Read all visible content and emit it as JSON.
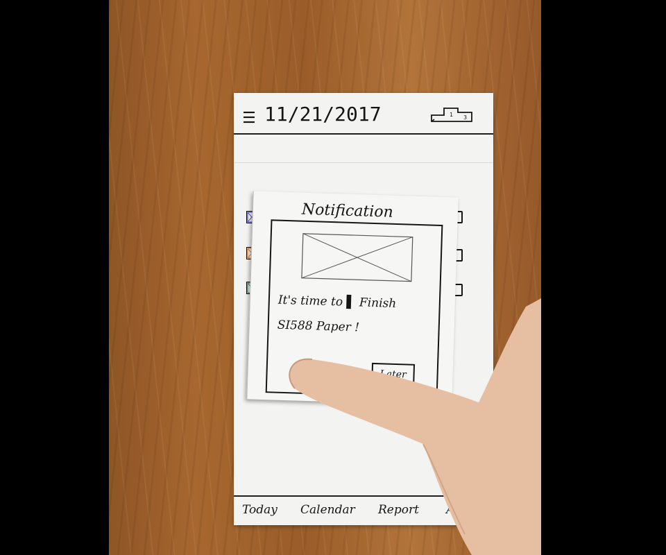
{
  "header": {
    "date": "11/21/2017",
    "menu_icon": "hamburger-menu-icon",
    "leaderboard_icon": "podium-icon"
  },
  "tasks": [
    {
      "color": "#5b5fc7"
    },
    {
      "color": "#e9842f"
    },
    {
      "color": "#4f8a6a"
    }
  ],
  "notification": {
    "title": "Notification",
    "message_line1": "It's time to ▌ Finish",
    "message_line2": "SI588 Paper !",
    "later_label": "Later",
    "image_icon": "image-placeholder-icon"
  },
  "nav": {
    "today": "Today",
    "calendar": "Calendar",
    "report": "Report",
    "more": "A"
  },
  "colors": {
    "paper": "#f3f3f1",
    "ink": "#151515",
    "wood": "#a7672f"
  }
}
